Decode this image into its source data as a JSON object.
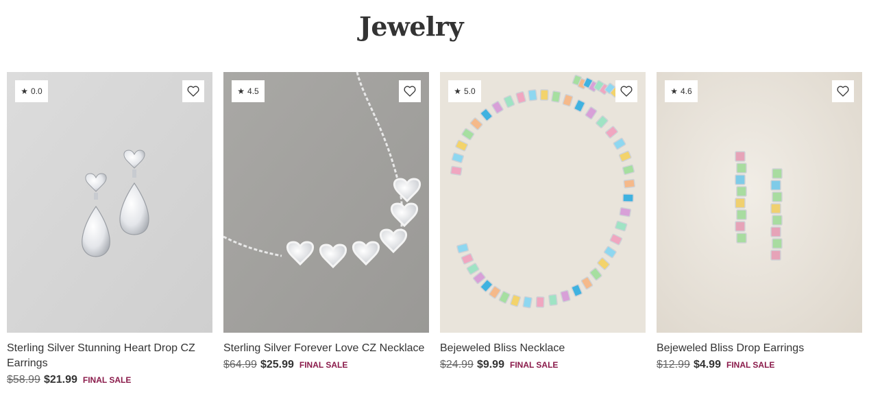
{
  "page": {
    "title": "Jewelry"
  },
  "products": [
    {
      "rating": "0.0",
      "rating_icon": "star-icon",
      "favorite_icon": "heart-outline-icon",
      "name": "Sterling Silver Stunning Heart Drop CZ Earrings",
      "original_price": "$58.99",
      "sale_price": "$21.99",
      "tag": "FINAL SALE",
      "image": "cz-heart-drop-earrings"
    },
    {
      "rating": "4.5",
      "rating_icon": "star-icon",
      "favorite_icon": "heart-outline-icon",
      "name": "Sterling Silver Forever Love CZ Necklace",
      "original_price": "$64.99",
      "sale_price": "$25.99",
      "tag": "FINAL SALE",
      "image": "heart-cz-necklace"
    },
    {
      "rating": "5.0",
      "rating_icon": "star-icon",
      "favorite_icon": "heart-outline-icon",
      "name": "Bejeweled Bliss Necklace",
      "original_price": "$24.99",
      "sale_price": "$9.99",
      "tag": "FINAL SALE",
      "image": "multicolor-gem-necklace"
    },
    {
      "rating": "4.6",
      "rating_icon": "star-icon",
      "favorite_icon": "heart-outline-icon",
      "name": "Bejeweled Bliss Drop Earrings",
      "original_price": "$12.99",
      "sale_price": "$4.99",
      "tag": "FINAL SALE",
      "image": "multicolor-gem-drop-earrings"
    }
  ],
  "colors": {
    "sale_tag": "#8a1a4a",
    "text": "#333333",
    "muted": "#666666"
  }
}
